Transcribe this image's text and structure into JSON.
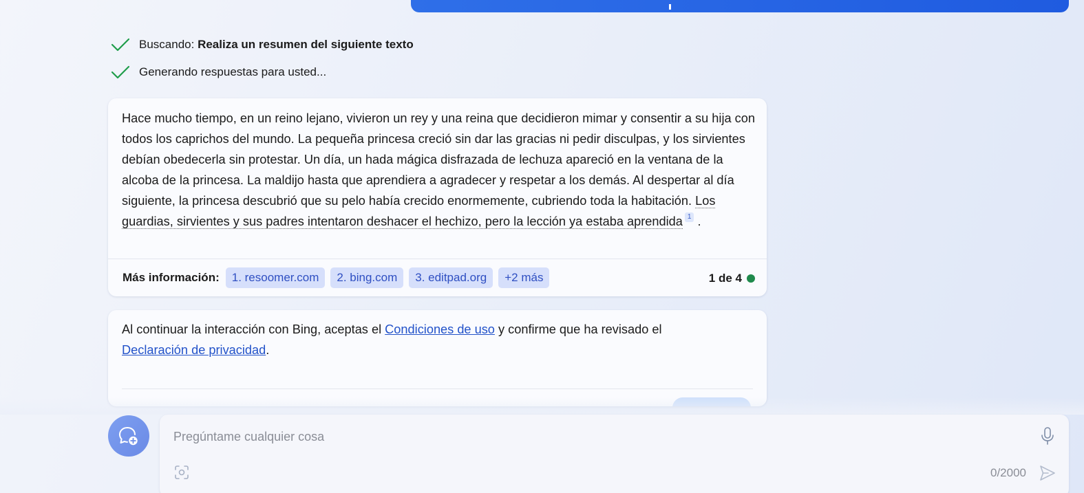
{
  "status": {
    "search_prefix": "Buscando:",
    "search_query": "Realiza un resumen del siguiente texto",
    "generating": "Generando respuestas para usted..."
  },
  "answer": {
    "text_main": "Hace mucho tiempo, en un reino lejano, vivieron un rey y una reina que decidieron mimar y consentir a su hija con todos los caprichos del mundo. La pequeña princesa creció sin dar las gracias ni pedir disculpas, y los sirvientes debían obedecerla sin protestar. Un día, un hada mágica disfrazada de lechuza apareció en la ventana de la alcoba de la princesa. La maldijo hasta que aprendiera a agradecer y respetar a los demás. Al despertar al día siguiente, la princesa descubrió que su pelo había crecido enormemente, cubriendo toda la habitación. ",
    "text_cited": "Los guardias, sirvientes y sus padres intentaron deshacer el hechizo, pero la lección ya estaba aprendida",
    "citation_number": "1",
    "text_end": " ."
  },
  "more_info": {
    "label": "Más información:",
    "sources": [
      "1. resoomer.com",
      "2. bing.com",
      "3. editpad.org",
      "+2 más"
    ],
    "page_count": "1 de 4",
    "status_color": "#1f8a4c"
  },
  "terms": {
    "text_before": "Al continuar la interacción con Bing, aceptas el ",
    "link_terms": "Condiciones de uso",
    "text_middle": " y confirme que ha revisado el ",
    "link_privacy": "Declaración de privacidad",
    "text_end": "."
  },
  "composer": {
    "placeholder": "Pregúntame cualquier cosa",
    "char_count": "0/2000"
  },
  "colors": {
    "accent": "#1f5be0",
    "link": "#2252c9",
    "chip_bg": "#d6dffb",
    "check": "#1f9d4a"
  },
  "icons": {
    "status_check": "check-icon",
    "new_topic": "new-topic-icon",
    "microphone": "microphone-icon",
    "camera": "visual-search-icon",
    "send": "send-icon"
  }
}
